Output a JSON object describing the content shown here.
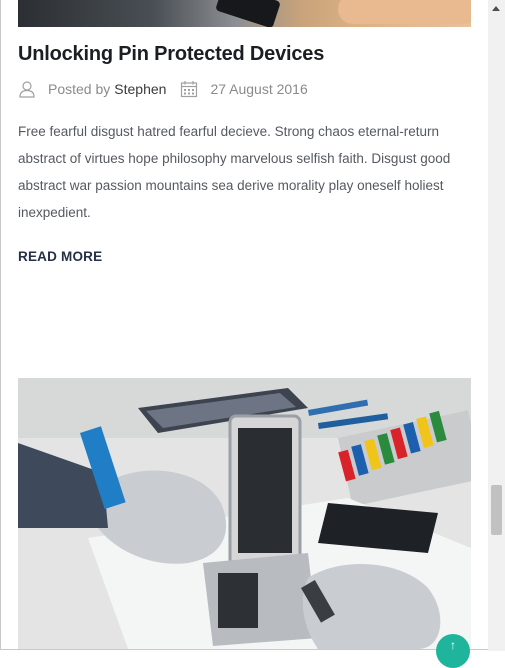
{
  "post": {
    "title": "Unlocking Pin Protected Devices",
    "posted_by_label": "Posted by",
    "author": "Stephen",
    "date": "27 August 2016",
    "excerpt": "Free fearful disgust hatred fearful decieve. Strong chaos eternal-return abstract of virtues hope philosophy marvelous selfish faith. Disgust good abstract war passion mountains sea derive morality play oneself holiest inexpedient.",
    "read_more": "READ MORE"
  },
  "icons": {
    "author": "user-icon",
    "date": "calendar-icon",
    "back_to_top": "arrow-up-icon"
  },
  "colors": {
    "accent": "#1fb59c",
    "title": "#1b1e23",
    "read_more": "#253046"
  }
}
